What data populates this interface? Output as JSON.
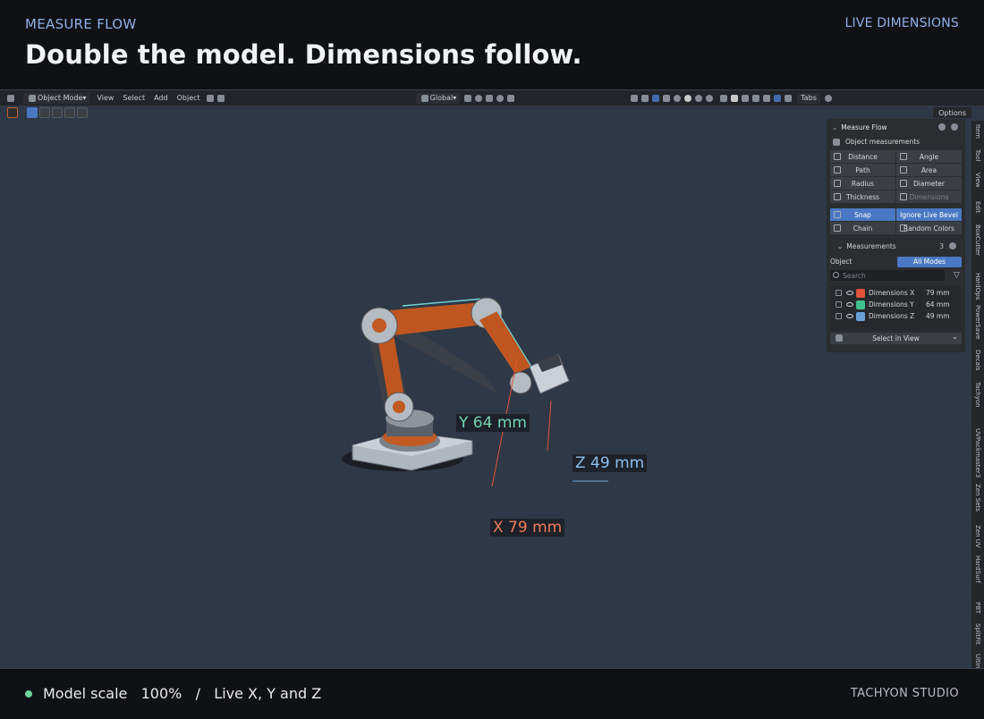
{
  "header": {
    "eyebrow": "MEASURE FLOW",
    "title": "Double the model. Dimensions follow.",
    "right_label": "LIVE DIMENSIONS"
  },
  "blender": {
    "menu": {
      "mode": "Object Mode",
      "view": "View",
      "select": "Select",
      "add": "Add",
      "object": "Object",
      "orientation": "Global",
      "tabs": "Tabs"
    },
    "options_label": "Options",
    "side_tabs": [
      "Item",
      "Tool",
      "View",
      "Edit",
      "BoxCutter",
      "HardOps",
      "PowerSave",
      "Decals",
      "Tachyon",
      "UVPackmaster3",
      "Zen Sets",
      "Zen UV",
      "HardSurf",
      "PBT",
      "SplitFit",
      "Ultim"
    ],
    "panel": {
      "title": "Measure Flow",
      "object_measurements": "Object measurements",
      "tools": [
        {
          "label": "Distance",
          "enabled": true
        },
        {
          "label": "Angle",
          "enabled": true
        },
        {
          "label": "Path",
          "enabled": true
        },
        {
          "label": "Area",
          "enabled": true
        },
        {
          "label": "Radius",
          "enabled": true
        },
        {
          "label": "Diameter",
          "enabled": true
        },
        {
          "label": "Thickness",
          "enabled": true
        },
        {
          "label": "Dimensions",
          "enabled": false
        }
      ],
      "snap": "Snap",
      "ignore_live_bevel": "Ignore Live Bevel",
      "chain": "Chain",
      "random_colors": "Random Colors",
      "measurements_label": "Measurements",
      "measurements_count": "3",
      "object_label": "Object",
      "all_modes": "All Modes",
      "search_placeholder": "Search",
      "items": [
        {
          "name": "Dimensions X",
          "value": "79 mm",
          "color": "#e0553a"
        },
        {
          "name": "Dimensions Y",
          "value": "64 mm",
          "color": "#3fc08c"
        },
        {
          "name": "Dimensions Z",
          "value": "49 mm",
          "color": "#6aa2d8"
        }
      ],
      "select_in_view": "Select in View"
    },
    "labels": {
      "y": "Y 64 mm",
      "z": "Z 49 mm",
      "x": "X 79 mm"
    }
  },
  "footer": {
    "scale_label": "Model scale",
    "scale_value": "100%",
    "separator": "/",
    "live": "Live X, Y and Z",
    "brand": "TACHYON STUDIO"
  },
  "colors": {
    "accent": "#4a78c4",
    "x": "#e0553a",
    "y": "#3fc08c",
    "z": "#6aa2d8",
    "status_dot": "#6fd49b"
  }
}
